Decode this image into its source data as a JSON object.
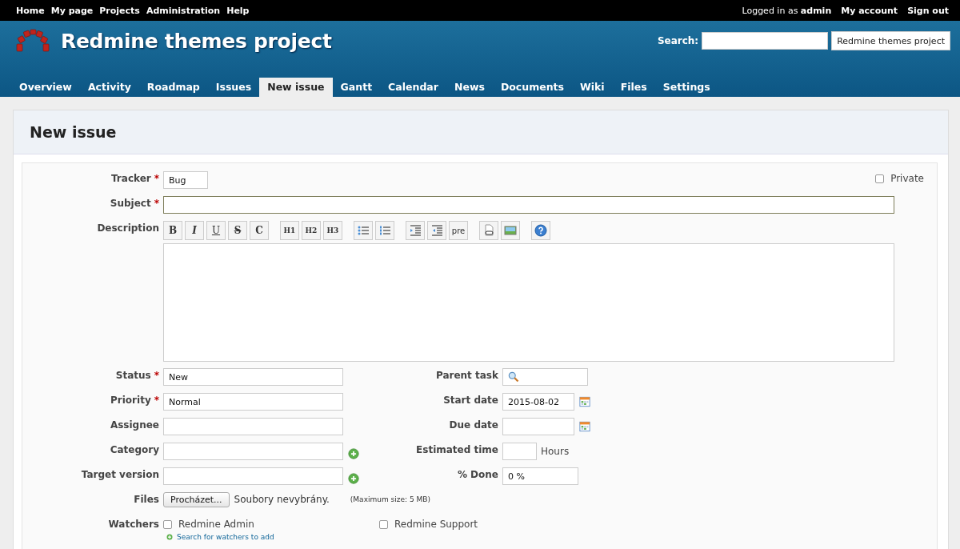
{
  "top_menu": {
    "left": [
      "Home",
      "My page",
      "Projects",
      "Administration",
      "Help"
    ],
    "logged_in_prefix": "Logged in as",
    "user": "admin",
    "right": [
      "My account",
      "Sign out"
    ]
  },
  "header": {
    "title": "Redmine themes project",
    "search_label": "Search:",
    "search_scope": "Redmine themes project"
  },
  "tabs": [
    {
      "label": "Overview",
      "selected": false
    },
    {
      "label": "Activity",
      "selected": false
    },
    {
      "label": "Roadmap",
      "selected": false
    },
    {
      "label": "Issues",
      "selected": false
    },
    {
      "label": "New issue",
      "selected": true
    },
    {
      "label": "Gantt",
      "selected": false
    },
    {
      "label": "Calendar",
      "selected": false
    },
    {
      "label": "News",
      "selected": false
    },
    {
      "label": "Documents",
      "selected": false
    },
    {
      "label": "Wiki",
      "selected": false
    },
    {
      "label": "Files",
      "selected": false
    },
    {
      "label": "Settings",
      "selected": false
    }
  ],
  "page_title": "New issue",
  "required_mark": "*",
  "tracker": {
    "label": "Tracker",
    "required": true,
    "value": "Bug"
  },
  "private": {
    "label": "Private",
    "checked": false
  },
  "subject": {
    "label": "Subject",
    "required": true
  },
  "description": {
    "label": "Description",
    "toolbar_text": [
      "B",
      "I",
      "U",
      "S",
      "C",
      "H1",
      "H2",
      "H3",
      "pre"
    ]
  },
  "left_fields": [
    {
      "label": "Status",
      "required": true,
      "value": "New",
      "add": false
    },
    {
      "label": "Priority",
      "required": true,
      "value": "Normal",
      "add": false
    },
    {
      "label": "Assignee",
      "required": false,
      "add": false
    },
    {
      "label": "Category",
      "required": false,
      "add": true
    },
    {
      "label": "Target version",
      "required": false,
      "add": true
    }
  ],
  "right_fields": [
    {
      "label": "Parent task",
      "kind": "search"
    },
    {
      "label": "Start date",
      "kind": "date",
      "value": "2015-08-02"
    },
    {
      "label": "Due date",
      "kind": "date"
    },
    {
      "label": "Estimated time",
      "kind": "hours",
      "unit": "Hours"
    },
    {
      "label": "% Done",
      "kind": "select",
      "value": "0 %"
    }
  ],
  "files": {
    "label": "Files",
    "button": "Procházet...",
    "status": "Soubory nevybrány.",
    "note": "(Maximum size: 5 MB)"
  },
  "watchers": {
    "label": "Watchers",
    "people": [
      {
        "name": "Redmine Admin",
        "checked": false
      },
      {
        "name": "Redmine Support",
        "checked": false
      }
    ],
    "search_link": "Search for watchers to add"
  }
}
